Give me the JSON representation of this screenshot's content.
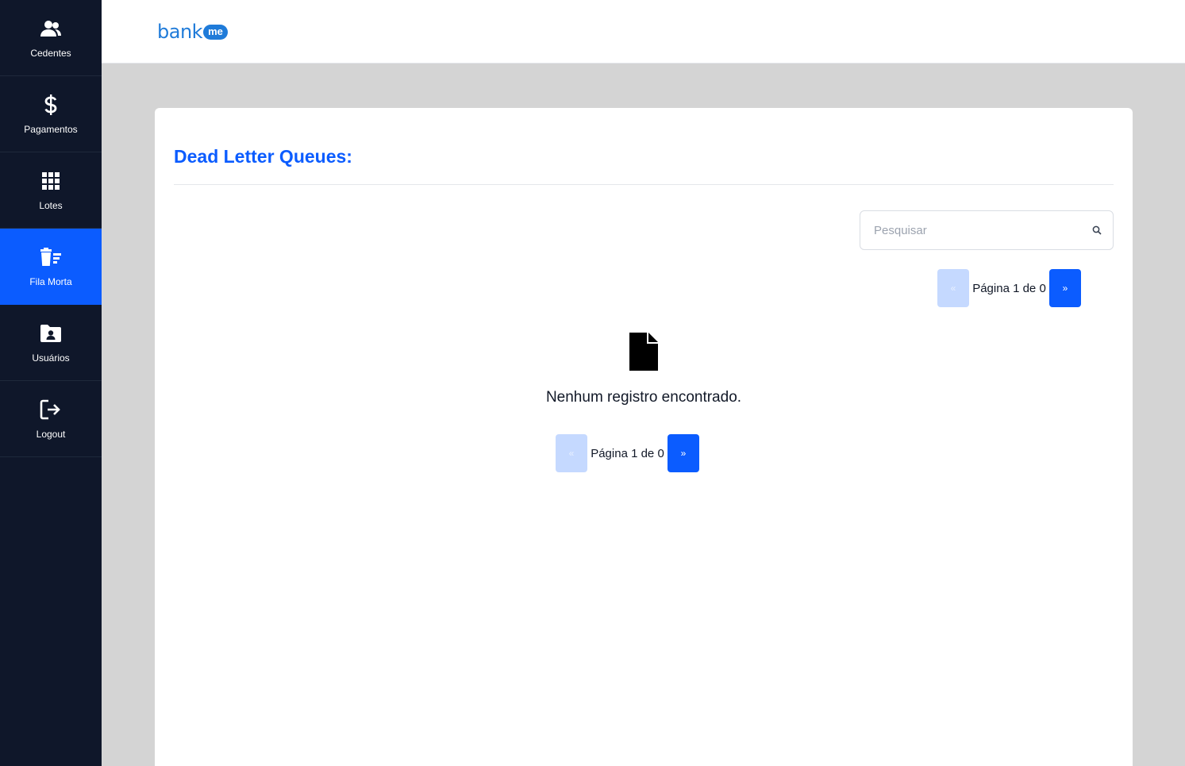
{
  "sidebar": {
    "items": [
      {
        "label": "Cedentes",
        "icon": "users-icon"
      },
      {
        "label": "Pagamentos",
        "icon": "dollar-icon"
      },
      {
        "label": "Lotes",
        "icon": "grid-icon"
      },
      {
        "label": "Fila Morta",
        "icon": "trash-list-icon",
        "active": true
      },
      {
        "label": "Usuários",
        "icon": "user-folder-icon"
      },
      {
        "label": "Logout",
        "icon": "logout-icon"
      }
    ]
  },
  "header": {
    "logo_word": "bank",
    "logo_pill": "me"
  },
  "main": {
    "title": "Dead Letter Queues:",
    "search": {
      "placeholder": "Pesquisar",
      "value": ""
    },
    "pagination_top": {
      "prev": "«",
      "info": "Página 1 de 0",
      "next": "»"
    },
    "empty_message": "Nenhum registro encontrado.",
    "pagination_bottom": {
      "prev": "«",
      "info": "Página 1 de 0",
      "next": "»"
    }
  },
  "colors": {
    "sidebar_bg": "#0f172a",
    "accent": "#0b5cff",
    "page_bg": "#d4d4d4",
    "logo": "#1f7bd9"
  }
}
